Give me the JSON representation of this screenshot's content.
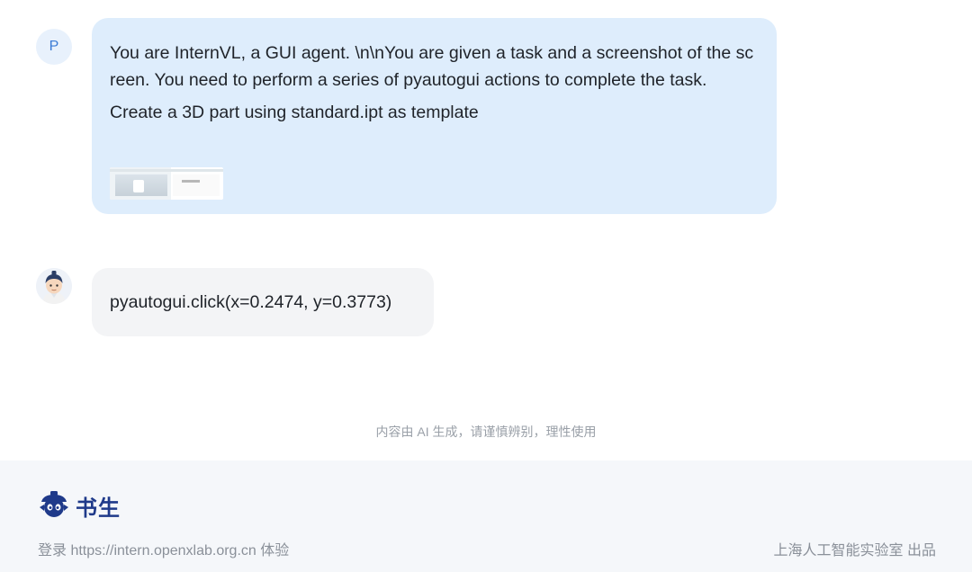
{
  "conversation": {
    "user": {
      "avatar_letter": "P",
      "prompt": "You are InternVL, a GUI agent. \\n\\nYou are given a task and a screenshot of the screen. You need to perform a series of pyautogui actions to complete the task.",
      "task": "Create a 3D part using standard.ipt as template"
    },
    "assistant": {
      "avatar_icon": "scholar-mascot-icon",
      "reply": "pyautogui.click(x=0.2474, y=0.3773)"
    }
  },
  "disclaimer": "内容由 AI 生成，请谨慎辨别，理性使用",
  "footer": {
    "logo_text": "书生",
    "link_text": "登录 https://intern.openxlab.org.cn 体验",
    "publisher_text": "上海人工智能实验室 出品"
  },
  "colors": {
    "user_bubble": "#deedfc",
    "assistant_bubble": "#f3f4f6",
    "footer_background": "#f5f7fa",
    "brand": "#1f3a8a"
  }
}
